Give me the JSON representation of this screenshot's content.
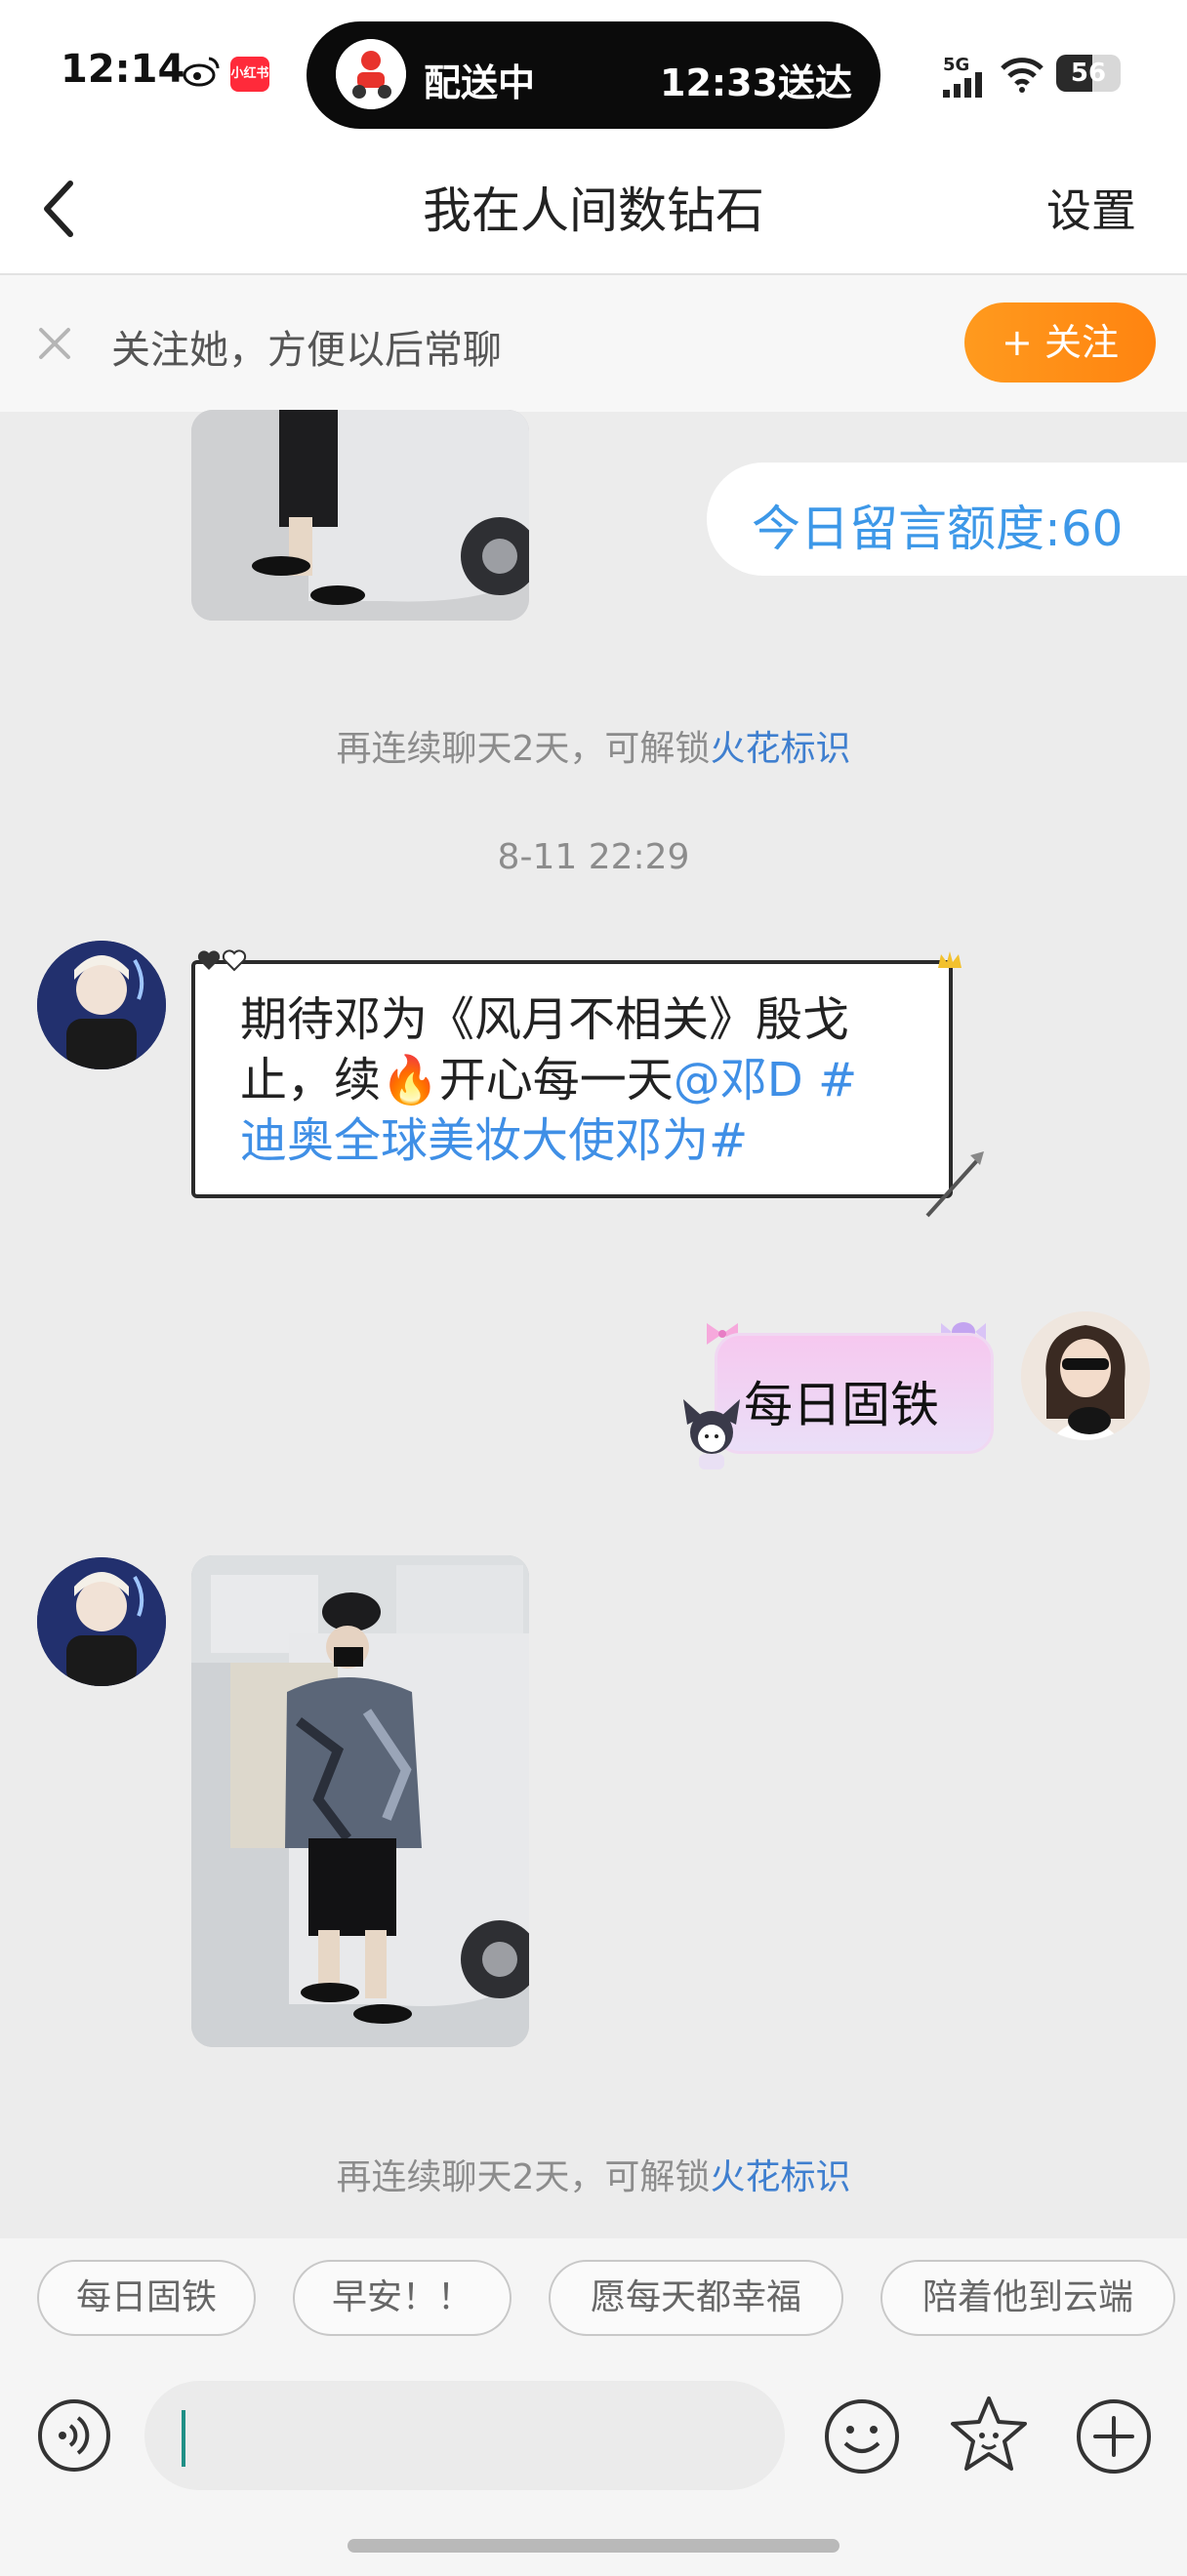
{
  "status_bar": {
    "time": "12:14",
    "badge_label": "小红书",
    "delivery_status": "配送中",
    "delivery_eta": "12:33送达",
    "network": "5G",
    "battery": "56",
    "battery_level": 0.56
  },
  "header": {
    "title": "我在人间数钻石",
    "settings_label": "设置"
  },
  "follow_banner": {
    "text": "关注她，方便以后常聊",
    "button_label": "+ 关注"
  },
  "quota": {
    "text": "今日留言额度:60"
  },
  "chat": {
    "notice_prefix": "再连续聊天2天，可解锁",
    "notice_link": "火花标识",
    "timestamp": "8-11 22:29",
    "incoming_message": {
      "line1": "期待邓为《风月不相关》殷戈",
      "line2_before_emoji": "止，续",
      "emoji": "🔥",
      "line2_after_emoji": "开心每一天",
      "mention": "@邓D",
      "topic_start": " #",
      "line3": "迪奥全球美妆大使邓为#"
    },
    "outgoing_message": {
      "text": "每日固铁"
    }
  },
  "quick_replies": [
    "每日固铁",
    "早安！！",
    "愿每天都幸福",
    "陪着他到云端"
  ],
  "icons": {
    "back": "chevron-left-icon",
    "close": "close-icon",
    "voice": "voice-icon",
    "emoji": "emoji-icon",
    "sticker": "sticker-icon",
    "plus": "plus-icon"
  },
  "colors": {
    "accent_orange": "#ff8e16",
    "link_blue": "#3f8fe6",
    "quota_blue": "#3d98e8",
    "chat_background": "#ececec"
  }
}
